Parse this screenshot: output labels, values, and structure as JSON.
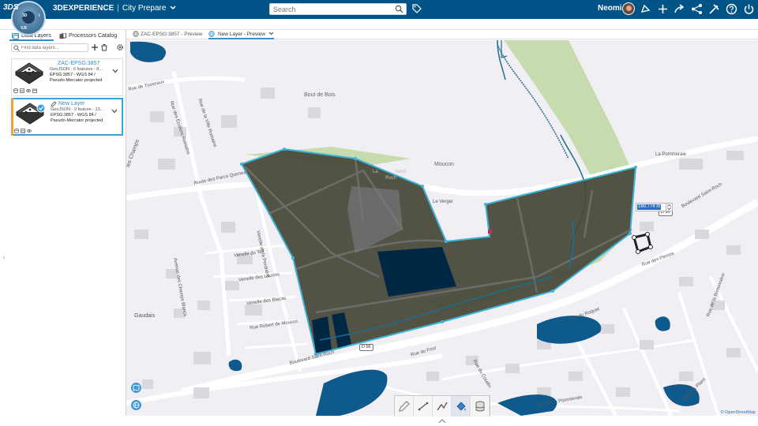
{
  "topbar": {
    "brand_bold": "3D",
    "brand_rest": "EXPERIENCE",
    "separator": "|",
    "app_name": "City Prepare",
    "search_placeholder": "Search",
    "user_name": "Neomi",
    "compass_labels": [
      "3D",
      "V.R",
      "i"
    ],
    "ds_logo": "3DS"
  },
  "left_panel": {
    "tabs": [
      {
        "label": "Data Layers",
        "active": true
      },
      {
        "label": "Processors Catalog",
        "active": false
      }
    ],
    "find_placeholder": "Find data layers...",
    "layers": [
      {
        "title": "ZAC-EPSG:3857",
        "line2": "GeoJSON - 6 features - 8...",
        "line3": "EPSG:3857 - WGS 84 /",
        "line4": "Pseudo-Mercator projected",
        "selected": false
      },
      {
        "title": "New Layer",
        "line2": "GeoJSON - 0 feature - 13...",
        "line3": "EPSG:3857 - WGS 84 /",
        "line4": "Pseudo-Mercator projected",
        "selected": true
      }
    ]
  },
  "map_tabs": [
    {
      "label": "ZAC-EPSG:3857 - Preview",
      "active": false
    },
    {
      "label": "New Layer - Preview",
      "active": true
    }
  ],
  "map": {
    "labels": {
      "bout_de_bois": "Bout de Bois",
      "moucon": "Moucon",
      "le_verger": "Le Verger",
      "la_pommeraie": "La Pommeraie",
      "saint_roch": "Saint-",
      "roch": "Roch",
      "la_goulai": "La",
      "rue_tusseaux": "Rue de Tusseaux",
      "route_parcs_quenea": "Route des Parcs Quenea",
      "rue_ville_romaine": "Rue de la Ville Romaine",
      "rue_ecoliers": "Rue des Écoliers Romains",
      "venelle_teil": "Venelle du Teil",
      "venelle_perdriere": "Venelle de la Perdrière",
      "venelle_laurins": "Venelle des Laurins",
      "venelle_blacas": "Venelle des Blacas",
      "rue_robert_moucon": "Rue Robert de Moucon",
      "avenue_champs_blancs": "Avenue des Champs Blancs",
      "bd_saint_roch_1": "Boulevard Saint-Roch",
      "bd_saint_roch_2": "Boulevard Saint-Roch",
      "bd_saint_roch_3": "Boulevard Saint-Roch",
      "rue_du_four": "Rue du Four",
      "rue_roquet": "Rue du Roquet",
      "rue_perrins": "Rue des Perrins",
      "rue_bretonniere": "Rue de la Bretonnière",
      "rue_coudin": "Rue du Coudin",
      "rue_pommeraie": "Rue de la Pommeraie",
      "les_champs": "les Champs",
      "gaudais": "Gaudais",
      "rue_plans": "Rue des Plans"
    },
    "road_badges": [
      "D 96",
      "D 96"
    ],
    "distance_value": "160.774 m",
    "attribution": "© OpenStreetMap"
  },
  "toolbar": {
    "tools": [
      "pencil-tool",
      "measure-tool",
      "line-tool",
      "paint-tool",
      "database-tool"
    ]
  },
  "colors": {
    "topbar": "#005386",
    "accent": "#368ec4",
    "polygon_fill": "#4a4a3b",
    "polygon_stroke": "#3cb4d8",
    "water": "#0f5a8c",
    "park": "#c7dcae"
  }
}
